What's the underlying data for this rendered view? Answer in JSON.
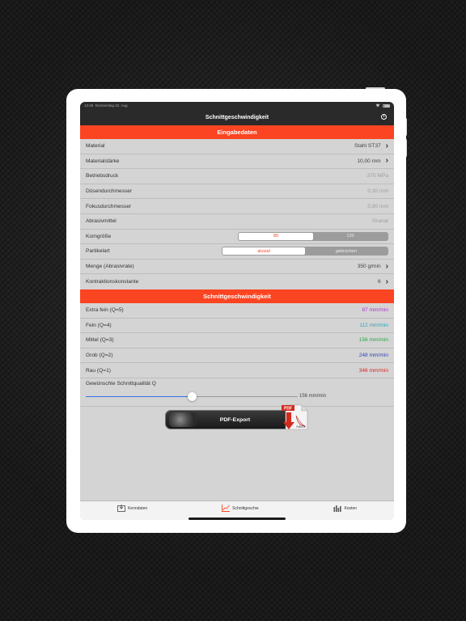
{
  "statusbar": {
    "time": "13:48",
    "date": "Donnerstag 22. Aug.",
    "battery": ""
  },
  "navbar": {
    "title": "Schnittgeschwindigkeit"
  },
  "input_section": {
    "header": "Eingabedaten",
    "rows": [
      {
        "label": "Material",
        "value": "Stahl ST37"
      },
      {
        "label": "Materialstärke",
        "value": "10,00 mm"
      },
      {
        "label": "Betriebsdruck",
        "value": "370 MPa"
      },
      {
        "label": "Düsendurchmesser",
        "value": "0,30 mm"
      },
      {
        "label": "Fokusdurchmesser",
        "value": "0,80 mm"
      },
      {
        "label": "Abrasivmittel",
        "value": "Granat"
      }
    ],
    "korngroesse": {
      "label": "Korngröße",
      "options": [
        "80",
        "120"
      ],
      "selected": 0
    },
    "partikelart": {
      "label": "Partikelart",
      "options": [
        "aluvial",
        "gebrochen"
      ],
      "selected": 0
    },
    "menge": {
      "label": "Menge (Abrasivrate)",
      "value": "350 g/min"
    },
    "kontraktion": {
      "label": "Kontraktionskonstante",
      "value": "6"
    }
  },
  "speed_section": {
    "header": "Schnittgeschwindigkeit",
    "rows": [
      {
        "label": "Extra fein (Q=5)",
        "value": "87 mm/min",
        "color": "#b22fd1"
      },
      {
        "label": "Fein (Q=4)",
        "value": "112 mm/min",
        "color": "#2aa7b8"
      },
      {
        "label": "Mittel (Q=3)",
        "value": "156 mm/min",
        "color": "#28a745"
      },
      {
        "label": "Grob (Q=2)",
        "value": "248 mm/min",
        "color": "#2e3fb3"
      },
      {
        "label": "Rau (Q=1)",
        "value": "346 mm/min",
        "color": "#e02222"
      }
    ],
    "slider": {
      "label": "Gewünschte Schnittqualität Q",
      "value_text": "156 mm/min",
      "level_fraction": 0.5
    }
  },
  "pdf": {
    "button_label": "PDF-Export",
    "doc_badge": "PDF",
    "doc_brand": "Adobe"
  },
  "tabbar": {
    "items": [
      {
        "label": "Kenndaten",
        "icon": "inbox-icon"
      },
      {
        "label": "Schnittgeschw.",
        "icon": "chart-icon",
        "active": true
      },
      {
        "label": "Kosten",
        "icon": "bar-chart-icon"
      }
    ]
  },
  "colors": {
    "accent": "#fb4421",
    "navbar": "#2a2a2a",
    "screen_bg": "#d4d4d4"
  }
}
